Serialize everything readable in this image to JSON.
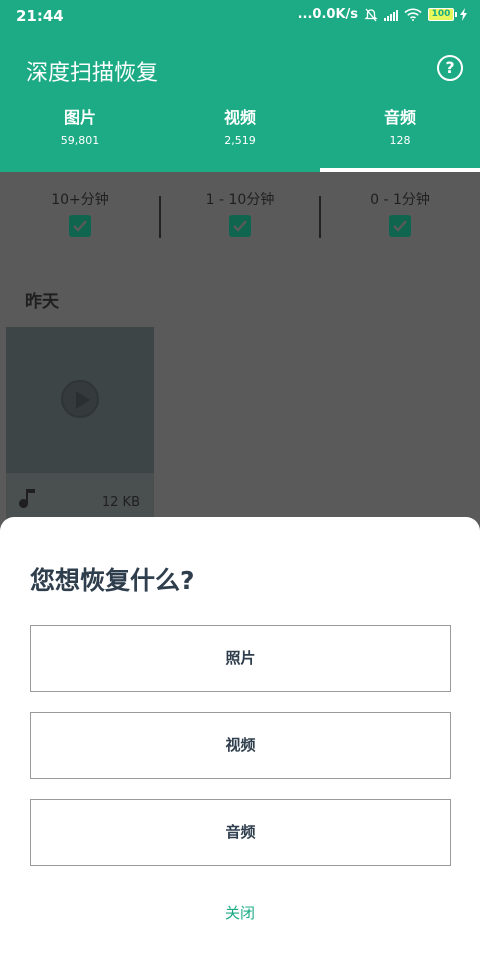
{
  "status_bar": {
    "time": "21:44",
    "network_speed": "...0.0K/s",
    "battery": "100",
    "icons": [
      "mute-icon",
      "signal-icon",
      "wifi-icon",
      "battery-icon",
      "charging-icon"
    ]
  },
  "app": {
    "title": "深度扫描恢复",
    "help_icon": "?",
    "accent_color": "#1cab85"
  },
  "tabs": [
    {
      "label": "图片",
      "count": "59,801"
    },
    {
      "label": "视频",
      "count": "2,519"
    },
    {
      "label": "音频",
      "count": "128",
      "active": true
    }
  ],
  "filters": [
    {
      "label": "10+分钟",
      "checked": true
    },
    {
      "label": "1 - 10分钟",
      "checked": true
    },
    {
      "label": "0 - 1分钟",
      "checked": true
    }
  ],
  "section": {
    "title": "昨天"
  },
  "media_items": [
    {
      "type": "audio",
      "size": "12 KB"
    }
  ],
  "dialog": {
    "title": "您想恢复什么?",
    "options": [
      "照片",
      "视频",
      "音频"
    ],
    "close_label": "关闭"
  }
}
